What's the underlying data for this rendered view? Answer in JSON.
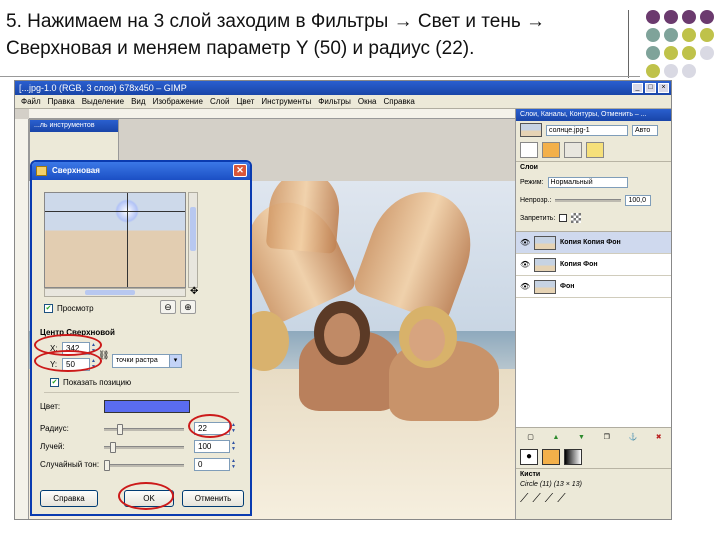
{
  "slide": {
    "title_line1": "5. Нажимаем на 3 слой заходим в Фильтры → Свет и тень →",
    "title_line2": "Сверхновая и меняем параметр Y (50) и радиус (22)."
  },
  "decor_dots": [
    {
      "color": "#6b3a6e"
    },
    {
      "color": "#6b3a6e"
    },
    {
      "color": "#6b3a6e"
    },
    {
      "color": "#6b3a6e"
    },
    {
      "color": "#7fa39a"
    },
    {
      "color": "#7fa39a"
    },
    {
      "color": "#bfc24a"
    },
    {
      "color": "#bfc24a"
    },
    {
      "color": "#7fa39a"
    },
    {
      "color": "#bfc24a"
    },
    {
      "color": "#bfc24a"
    },
    {
      "color": "#d9d9e3"
    },
    {
      "color": "#bfc24a"
    },
    {
      "color": "#d9d9e3"
    },
    {
      "color": "#d9d9e3"
    }
  ],
  "gimp": {
    "window_title": "[...jpg-1.0 (RGB, 3 слоя) 678x450 – GIMP",
    "menu": [
      "Файл",
      "Правка",
      "Выделение",
      "Вид",
      "Изображение",
      "Слой",
      "Цвет",
      "Инструменты",
      "Фильтры",
      "Окна",
      "Справка"
    ],
    "toolbox_title": "...ль инструментов"
  },
  "dock": {
    "title": "Слои, Каналы, Контуры, Отменить – ...",
    "image_selector": "солнце.jpg-1",
    "auto_button": "Авто",
    "layers_label": "Слои",
    "mode_label": "Режим:",
    "mode_value": "Нормальный",
    "opacity_label": "Непрозр.:",
    "opacity_value": "100,0",
    "lock_label": "Запретить:",
    "layers": [
      {
        "name": "Копия Копия Фон",
        "selected": true
      },
      {
        "name": "Копия Фон",
        "selected": false
      },
      {
        "name": "Фон",
        "selected": false
      }
    ],
    "brushes_label": "Кисти",
    "brush_name": "Circle (11) (13 × 13)"
  },
  "dialog": {
    "title": "Сверхновая",
    "preview_checkbox_label": "Просмотр",
    "preview_checked": true,
    "center_group_label": "Центр Сверхновой",
    "x_label": "X:",
    "x_value": "342",
    "y_label": "Y:",
    "y_value": "50",
    "units_value": "точки растра",
    "show_position_label": "Показать позицию",
    "show_position_checked": true,
    "color_label": "Цвет:",
    "color_value": "#5a6cf0",
    "radius_label": "Радиус:",
    "radius_value": "22",
    "radius_fraction": 0.18,
    "spokes_label": "Лучей:",
    "spokes_value": "100",
    "spokes_fraction": 0.08,
    "random_hue_label": "Случайный тон:",
    "random_hue_value": "0",
    "random_hue_fraction": 0.0,
    "help_button": "Справка",
    "ok_button": "OK",
    "cancel_button": "Отменить"
  }
}
